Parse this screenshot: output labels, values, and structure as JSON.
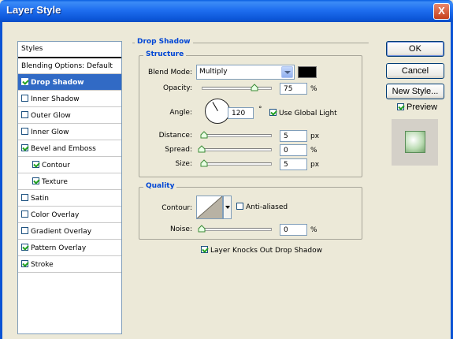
{
  "window": {
    "title": "Layer Style",
    "close_glyph": "X"
  },
  "styles_list": {
    "header": "Styles",
    "blending_options": "Blending Options: Default",
    "items": [
      {
        "label": "Drop Shadow",
        "checked": true,
        "selected": true,
        "sub": false
      },
      {
        "label": "Inner Shadow",
        "checked": false,
        "selected": false,
        "sub": false
      },
      {
        "label": "Outer Glow",
        "checked": false,
        "selected": false,
        "sub": false
      },
      {
        "label": "Inner Glow",
        "checked": false,
        "selected": false,
        "sub": false
      },
      {
        "label": "Bevel and Emboss",
        "checked": true,
        "selected": false,
        "sub": false
      },
      {
        "label": "Contour",
        "checked": true,
        "selected": false,
        "sub": true
      },
      {
        "label": "Texture",
        "checked": true,
        "selected": false,
        "sub": true
      },
      {
        "label": "Satin",
        "checked": false,
        "selected": false,
        "sub": false
      },
      {
        "label": "Color Overlay",
        "checked": false,
        "selected": false,
        "sub": false
      },
      {
        "label": "Gradient Overlay",
        "checked": false,
        "selected": false,
        "sub": false
      },
      {
        "label": "Pattern Overlay",
        "checked": true,
        "selected": false,
        "sub": false
      },
      {
        "label": "Stroke",
        "checked": true,
        "selected": false,
        "sub": false
      }
    ]
  },
  "drop_shadow": {
    "legend": "Drop Shadow",
    "structure": {
      "legend": "Structure",
      "blend_mode_label": "Blend Mode:",
      "blend_mode_value": "Multiply",
      "shadow_color": "#000000",
      "opacity_label": "Opacity:",
      "opacity_value": "75",
      "opacity_unit": "%",
      "opacity_level": 0.75,
      "angle_label": "Angle:",
      "angle_value": "120",
      "angle_unit": "°",
      "use_global_light_label": "Use Global Light",
      "use_global_light_checked": true,
      "distance_label": "Distance:",
      "distance_value": "5",
      "distance_unit": "px",
      "spread_label": "Spread:",
      "spread_value": "0",
      "spread_unit": "%",
      "size_label": "Size:",
      "size_value": "5",
      "size_unit": "px"
    },
    "quality": {
      "legend": "Quality",
      "contour_label": "Contour:",
      "anti_aliased_label": "Anti-aliased",
      "anti_aliased_checked": false,
      "noise_label": "Noise:",
      "noise_value": "0",
      "noise_unit": "%"
    },
    "layer_knocks_out_label": "Layer Knocks Out Drop Shadow",
    "layer_knocks_out_checked": true
  },
  "buttons": {
    "ok": "OK",
    "cancel": "Cancel",
    "new_style": "New Style...",
    "preview_label": "Preview",
    "preview_checked": true
  },
  "colors": {
    "accent": "#0046d5",
    "selection": "#316ac5",
    "titlebar": "#0a5fe0"
  }
}
